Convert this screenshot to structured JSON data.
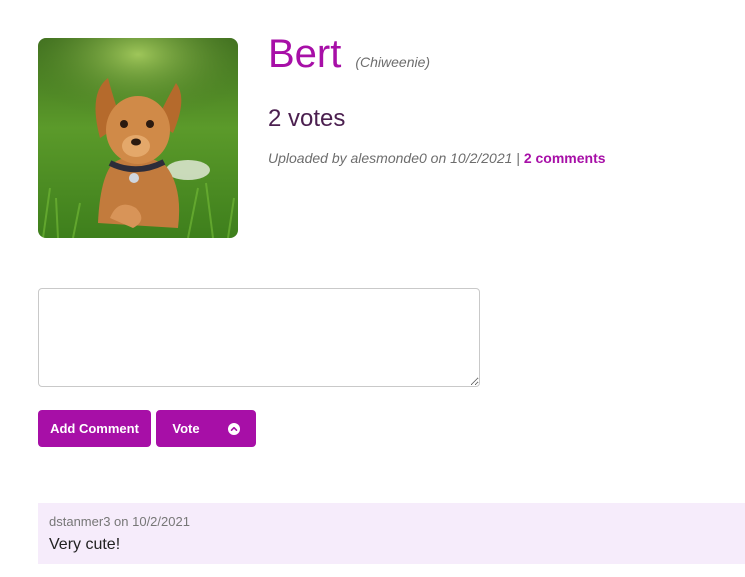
{
  "pet": {
    "name": "Bert",
    "breed": "(Chiweenie)",
    "votes": "2 votes",
    "uploaded_text": "Uploaded by alesmonde0 on 10/2/2021",
    "separator": "|",
    "comments_link": "2 comments",
    "photo_icon": "dog-photo"
  },
  "comment_form": {
    "textarea_value": "",
    "add_comment_label": "Add Comment",
    "vote_label": "Vote",
    "vote_icon": "chevron-up-circle-icon"
  },
  "comments": [
    {
      "meta": "dstanmer3 on 10/2/2021",
      "text": "Very cute!"
    }
  ],
  "colors": {
    "accent": "#a70fa7",
    "votes_text": "#4b1f4f",
    "comment_bg": "#f6ecfb"
  }
}
